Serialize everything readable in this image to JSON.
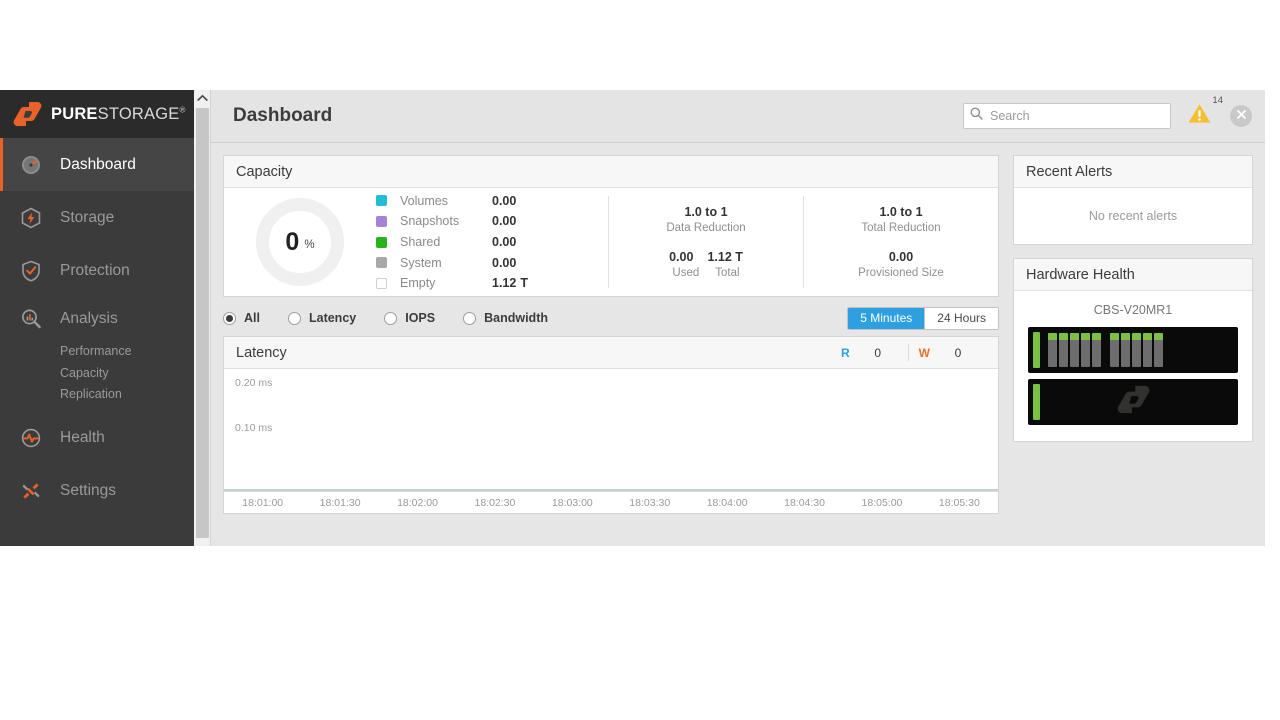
{
  "brand": {
    "name_bold": "PURE",
    "name_thin": "STORAGE",
    "registered": "®",
    "accent": "#e8622a"
  },
  "sidebar": {
    "items": [
      {
        "label": "Dashboard",
        "icon": "gauge-icon",
        "active": true
      },
      {
        "label": "Storage",
        "icon": "storage-bolt-icon",
        "active": false
      },
      {
        "label": "Protection",
        "icon": "shield-check-icon",
        "active": false
      },
      {
        "label": "Analysis",
        "icon": "magnifier-chart-icon",
        "active": false
      },
      {
        "label": "Health",
        "icon": "heartbeat-icon",
        "active": false
      },
      {
        "label": "Settings",
        "icon": "wrench-icon",
        "active": false
      }
    ],
    "analysis_subitems": [
      {
        "label": "Performance"
      },
      {
        "label": "Capacity"
      },
      {
        "label": "Replication"
      }
    ]
  },
  "header": {
    "title": "Dashboard",
    "search": {
      "placeholder": "Search",
      "value": ""
    },
    "alert_icon": "warning-triangle-icon",
    "alert_count": "14",
    "close_icon": "close-icon"
  },
  "capacity": {
    "title": "Capacity",
    "percent": "0",
    "percent_unit": "%",
    "legend": [
      {
        "label": "Volumes",
        "value": "0.00",
        "unit": "",
        "color": "#22bcd4"
      },
      {
        "label": "Snapshots",
        "value": "0.00",
        "unit": "",
        "color": "#a584d6"
      },
      {
        "label": "Shared",
        "value": "0.00",
        "unit": "",
        "color": "#27b31a"
      },
      {
        "label": "System",
        "value": "0.00",
        "unit": "",
        "color": "#a8a8a8"
      },
      {
        "label": "Empty",
        "value": "1.12",
        "unit": "T",
        "color": "#ffffff"
      }
    ],
    "data_reduction": {
      "value": "1.0 to 1",
      "label": "Data Reduction"
    },
    "usage": {
      "used_value": "0.00",
      "total_value": "1.12 T",
      "used_label": "Used",
      "total_label": "Total"
    },
    "total_reduction": {
      "value": "1.0 to 1",
      "label": "Total Reduction"
    },
    "provisioned": {
      "value": "0.00",
      "label": "Provisioned Size"
    }
  },
  "filters": {
    "options": [
      {
        "label": "All",
        "selected": true
      },
      {
        "label": "Latency",
        "selected": false
      },
      {
        "label": "IOPS",
        "selected": false
      },
      {
        "label": "Bandwidth",
        "selected": false
      }
    ],
    "ranges": [
      {
        "label": "5 Minutes",
        "selected": true
      },
      {
        "label": "24 Hours",
        "selected": false
      }
    ]
  },
  "chart_data": {
    "type": "line",
    "title": "Latency",
    "xlabel": "",
    "ylabel": "ms",
    "ylim": [
      0,
      0.25
    ],
    "yticks": [
      "0.20 ms",
      "0.10 ms"
    ],
    "grid": false,
    "legend_position": "header-right",
    "x": [
      "18:01:00",
      "18:01:30",
      "18:02:00",
      "18:02:30",
      "18:03:00",
      "18:03:30",
      "18:04:00",
      "18:04:30",
      "18:05:00",
      "18:05:30"
    ],
    "series": [
      {
        "name": "R",
        "label": "R",
        "current": "0",
        "color": "#2e9fe0",
        "values": [
          0,
          0,
          0,
          0,
          0,
          0,
          0,
          0,
          0,
          0
        ]
      },
      {
        "name": "W",
        "label": "W",
        "current": "0",
        "color": "#e8722a",
        "values": [
          0,
          0,
          0,
          0,
          0,
          0,
          0,
          0,
          0,
          0
        ]
      }
    ]
  },
  "alerts": {
    "title": "Recent Alerts",
    "empty_text": "No recent alerts"
  },
  "hardware": {
    "title": "Hardware Health",
    "device_name": "CBS-V20MR1",
    "chassis": [
      {
        "led_color": "#7bc043",
        "bay_groups": [
          5,
          5
        ],
        "logo": false
      },
      {
        "led_color": "#7bc043",
        "bay_groups": [],
        "logo": true
      }
    ]
  }
}
